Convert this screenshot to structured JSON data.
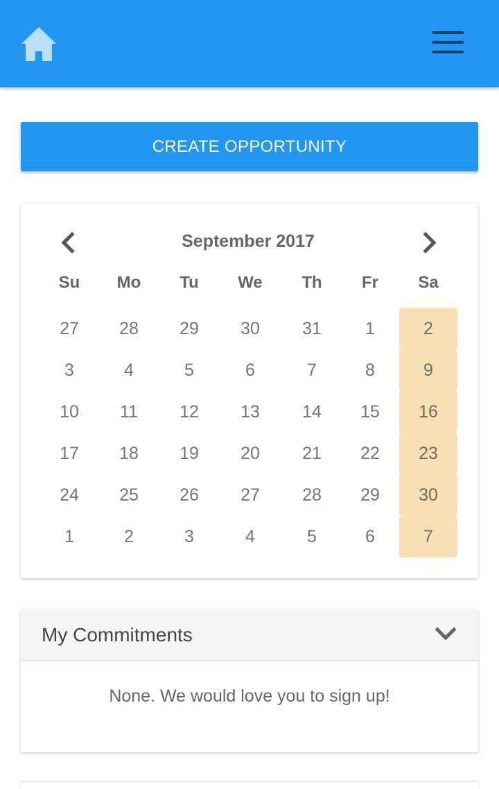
{
  "header": {
    "home_icon": "home-icon",
    "menu_icon": "hamburger-menu-icon",
    "colors": {
      "bar": "#2196f3",
      "home_icon": "#bbdefb",
      "menu_icon": "#1f3f63"
    }
  },
  "create_button": {
    "label": "Create Opportunity"
  },
  "calendar": {
    "title": "September 2017",
    "prev_icon": "chevron-left-icon",
    "next_icon": "chevron-right-icon",
    "weekdays": [
      "Su",
      "Mo",
      "Tu",
      "We",
      "Th",
      "Fr",
      "Sa"
    ],
    "highlight_color": "#f5dfb3",
    "weeks": [
      [
        "27",
        "28",
        "29",
        "30",
        "31",
        "1",
        "2"
      ],
      [
        "3",
        "4",
        "5",
        "6",
        "7",
        "8",
        "9"
      ],
      [
        "10",
        "11",
        "12",
        "13",
        "14",
        "15",
        "16"
      ],
      [
        "17",
        "18",
        "19",
        "20",
        "21",
        "22",
        "23"
      ],
      [
        "24",
        "25",
        "26",
        "27",
        "28",
        "29",
        "30"
      ],
      [
        "1",
        "2",
        "3",
        "4",
        "5",
        "6",
        "7"
      ]
    ],
    "highlighted_column": "Sa"
  },
  "commitments": {
    "title": "My Commitments",
    "toggle_icon": "chevron-down-icon",
    "empty_message": "None. We would love you to sign up!"
  }
}
